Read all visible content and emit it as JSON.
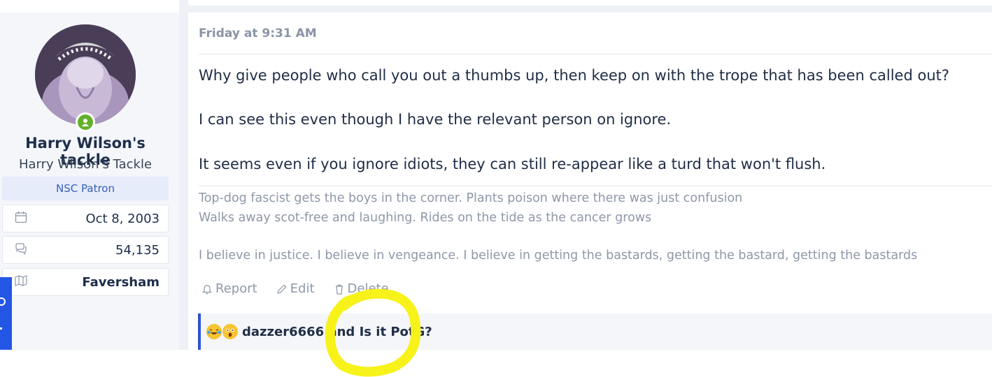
{
  "user": {
    "name": "Harry Wilson's tackle",
    "title": "Harry Wilson's Tackle",
    "banner": "NSC Patron",
    "avatar_icon": "avatar-image",
    "online_icon": "online-status-icon",
    "stats": [
      {
        "icon": "calendar-icon",
        "value": "Oct 8, 2003"
      },
      {
        "icon": "messages-icon",
        "value": "54,135"
      },
      {
        "icon": "map-icon",
        "value": "Faversham"
      }
    ]
  },
  "post": {
    "date": "Friday at 9:31 AM",
    "paragraphs": [
      "Why give people who call you out a thumbs up, then keep on with the trope that has been called out?",
      "I can see this even though I have the relevant person on ignore.",
      "It seems even if you ignore idiots, they can still re-appear like a turd that won't flush."
    ],
    "signature": [
      "Top-dog fascist gets the boys in the corner. Plants poison where there was just confusion",
      "Walks away scot-free and laughing. Rides on the tide as the cancer grows",
      "I believe in justice. I believe in vengeance. I believe in getting the bastards, getting the bastard, getting the bastards"
    ],
    "actions": {
      "report": "Report",
      "edit": "Edit",
      "delete": "Delete"
    },
    "reactions": {
      "emojis": [
        "laughing-crying-emoji",
        "astonished-emoji"
      ],
      "user": "dazzer6666",
      "and": "and",
      "other": "Is it PotG?"
    }
  },
  "colors": {
    "accent": "#2d52d6",
    "banner_bg": "#e7ecfb",
    "online": "#63b12a",
    "highlight": "#f7f21a"
  }
}
